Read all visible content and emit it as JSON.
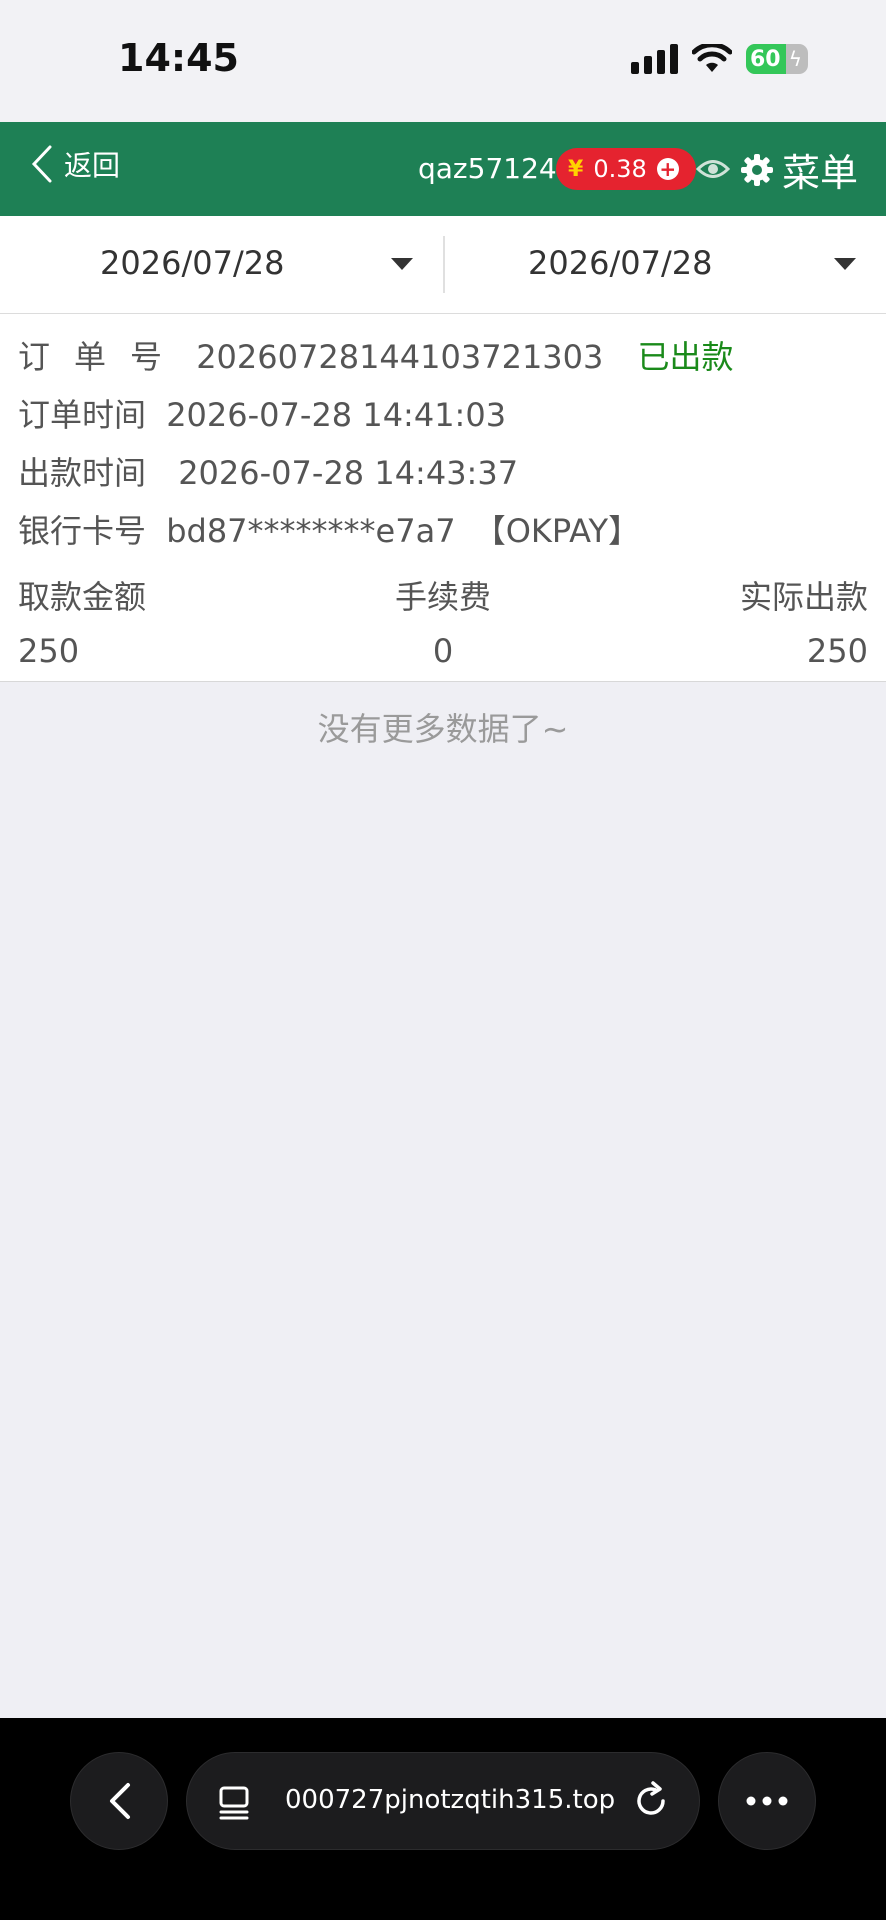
{
  "status_bar": {
    "time": "14:45",
    "battery": "60"
  },
  "header": {
    "back_label": "返回",
    "username": "qaz571241",
    "currency_symbol": "¥",
    "balance": "0.38",
    "menu_label": "菜单"
  },
  "filter": {
    "start_date": "2026/07/28",
    "end_date": "2026/07/28"
  },
  "record": {
    "order_no_label": "订单号",
    "order_no": "20260728144103721303",
    "status": "已出款",
    "order_time_label": "订单时间",
    "order_time": "2026-07-28 14:41:03",
    "payout_time_label": "出款时间",
    "payout_time": "2026-07-28 14:43:37",
    "bank_label": "银行卡号",
    "bank_no": "bd87********e7a7",
    "bank_tag": "【OKPAY】",
    "amount_label": "取款金额",
    "amount": "250",
    "fee_label": "手续费",
    "fee": "0",
    "actual_label": "实际出款",
    "actual": "250"
  },
  "list_end_text": "没有更多数据了~",
  "browser": {
    "url": "000727pjnotzqtih315.top"
  },
  "colors": {
    "header_bg": "#1e8055",
    "status_ok": "#1a8a1a",
    "balance_bg": "#e5232f"
  }
}
